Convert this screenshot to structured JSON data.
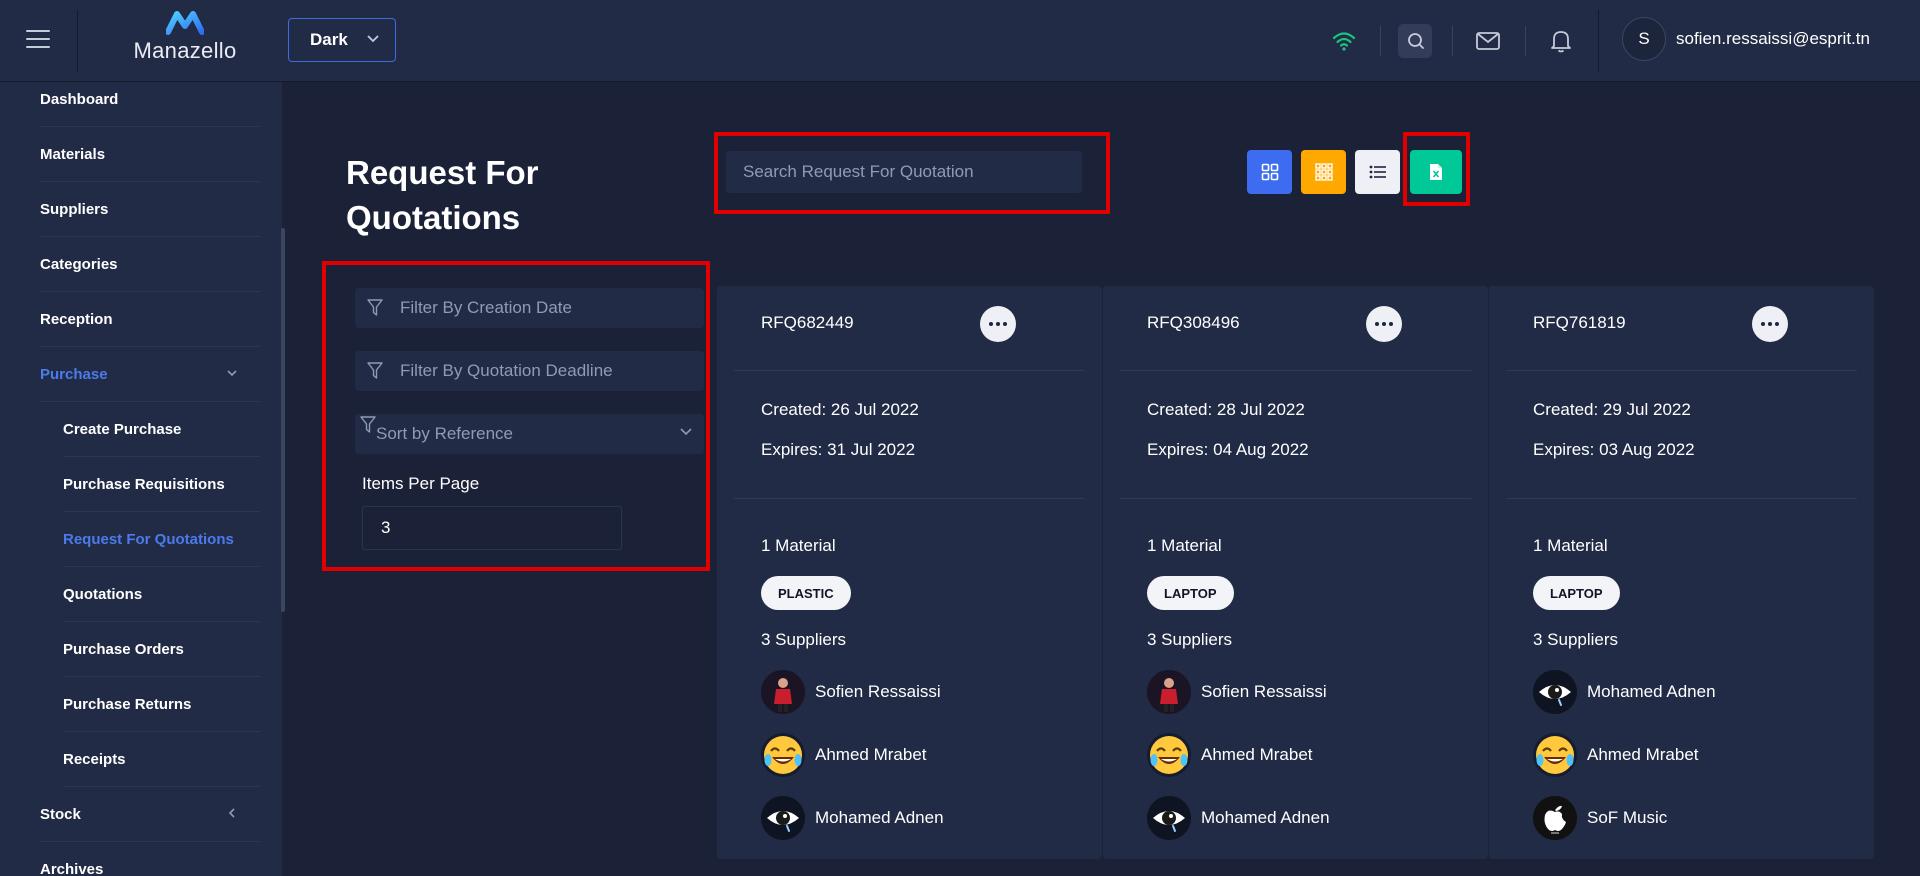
{
  "header": {
    "app_name": "Manazello",
    "theme": "Dark",
    "user_initial": "S",
    "user_email": "sofien.ressaissi@esprit.tn"
  },
  "colors": {
    "accent": "#3f6ae0",
    "highlight_red": "#e00000",
    "wifi_green": "#1bc47d",
    "grid_button": "#3d6cf0",
    "apps_button": "#ffa800",
    "list_button": "#eef0f5",
    "excel_button": "#00c896"
  },
  "sidebar": {
    "items": [
      {
        "label": "Dashboard",
        "active": false
      },
      {
        "label": "Materials",
        "active": false
      },
      {
        "label": "Suppliers",
        "active": false
      },
      {
        "label": "Categories",
        "active": false
      },
      {
        "label": "Reception",
        "active": false
      },
      {
        "label": "Purchase",
        "active": true,
        "expanded": true
      },
      {
        "label": "Create Purchase",
        "active": false
      },
      {
        "label": "Purchase Requisitions",
        "active": false
      },
      {
        "label": "Request For Quotations",
        "active": true
      },
      {
        "label": "Quotations",
        "active": false
      },
      {
        "label": "Purchase Orders",
        "active": false
      },
      {
        "label": "Purchase Returns",
        "active": false
      },
      {
        "label": "Receipts",
        "active": false
      },
      {
        "label": "Stock",
        "active": false,
        "expanded": false
      },
      {
        "label": "Archives",
        "active": false
      }
    ]
  },
  "main": {
    "title_line1": "Request For",
    "title_line2": "Quotations",
    "search_placeholder": "Search Request For Quotation",
    "view_buttons": [
      "grid-view-icon",
      "apps-view-icon",
      "list-view-icon",
      "excel-export-icon"
    ]
  },
  "filters": {
    "creation_date_placeholder": "Filter By Creation Date",
    "deadline_placeholder": "Filter By Quotation Deadline",
    "sort_placeholder": "Sort by Reference",
    "items_per_page_label": "Items Per Page",
    "items_per_page_value": "3"
  },
  "cards": [
    {
      "ref": "RFQ682449",
      "created": "Created: 26 Jul 2022",
      "expires": "Expires: 31 Jul 2022",
      "materials_count": "1 Material",
      "tag": "PLASTIC",
      "suppliers_count": "3 Suppliers",
      "suppliers": [
        {
          "name": "Sofien Ressaissi",
          "avatar": "person-photo"
        },
        {
          "name": "Ahmed Mrabet",
          "avatar": "laughing-emoji"
        },
        {
          "name": "Mohamed Adnen",
          "avatar": "eye-icon"
        }
      ]
    },
    {
      "ref": "RFQ308496",
      "created": "Created: 28 Jul 2022",
      "expires": "Expires: 04 Aug 2022",
      "materials_count": "1 Material",
      "tag": "LAPTOP",
      "suppliers_count": "3 Suppliers",
      "suppliers": [
        {
          "name": "Sofien Ressaissi",
          "avatar": "person-photo"
        },
        {
          "name": "Ahmed Mrabet",
          "avatar": "laughing-emoji"
        },
        {
          "name": "Mohamed Adnen",
          "avatar": "eye-icon"
        }
      ]
    },
    {
      "ref": "RFQ761819",
      "created": "Created: 29 Jul 2022",
      "expires": "Expires: 03 Aug 2022",
      "materials_count": "1 Material",
      "tag": "LAPTOP",
      "suppliers_count": "3 Suppliers",
      "suppliers": [
        {
          "name": "Mohamed Adnen",
          "avatar": "eye-icon"
        },
        {
          "name": "Ahmed Mrabet",
          "avatar": "laughing-emoji"
        },
        {
          "name": "SoF Music",
          "avatar": "apple-logo"
        }
      ]
    }
  ]
}
